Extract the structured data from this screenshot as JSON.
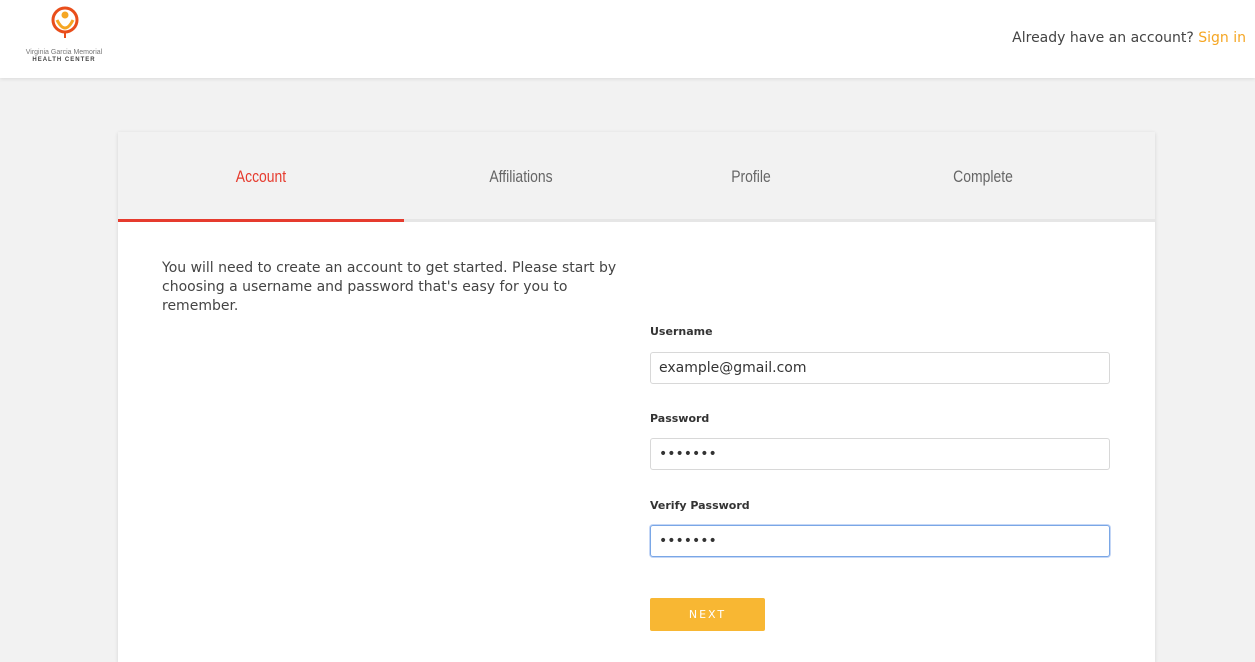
{
  "header": {
    "logo": {
      "line1": "Virginia Garcia Memorial",
      "line2": "HEALTH CENTER",
      "icon": "vgm-logo-icon"
    },
    "signin_prompt": "Already have an account?",
    "signin_link": "Sign in"
  },
  "tabs": [
    {
      "label": "Account",
      "active": true
    },
    {
      "label": "Affiliations",
      "active": false
    },
    {
      "label": "Profile",
      "active": false
    },
    {
      "label": "Complete",
      "active": false
    }
  ],
  "intro": "You will need to create an account to get started. Please start by choosing a username and password that's easy for you to remember.",
  "form": {
    "username": {
      "label": "Username",
      "value": "example@gmail.com"
    },
    "password": {
      "label": "Password",
      "value": "•••••••"
    },
    "verify_password": {
      "label": "Verify Password",
      "value": "•••••••",
      "focused": true
    },
    "next_label": "NEXT"
  },
  "colors": {
    "accent_red": "#e63b2e",
    "accent_orange": "#f5a623",
    "button_yellow": "#f8b733",
    "page_bg": "#f2f2f2",
    "focus_blue": "#7aa7e6"
  }
}
